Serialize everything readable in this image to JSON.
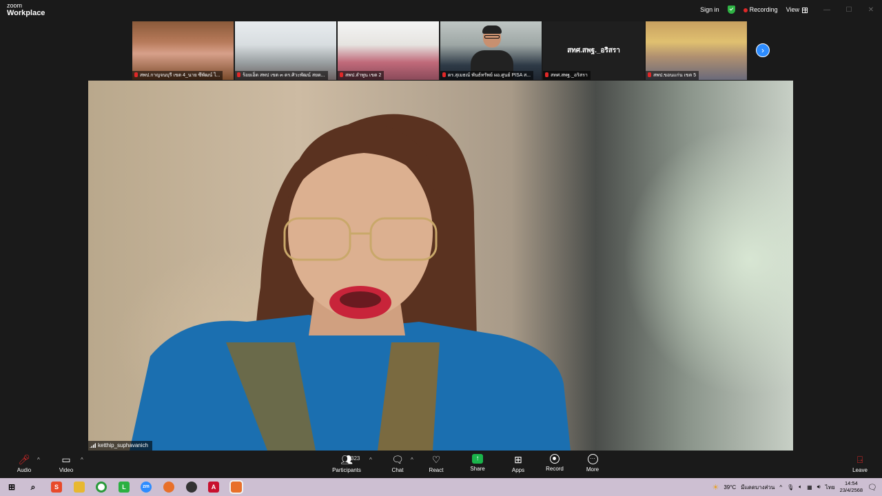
{
  "app": {
    "logo_small": "zoom",
    "logo_big": "Workplace",
    "sign_in": "Sign in",
    "recording": "Recording",
    "view": "View"
  },
  "participants_strip": [
    {
      "label": "สพป.กาญจนบุรี เขต 4_นาย ซึพัฒน์ ไ..."
    },
    {
      "label": "ร้อยเอ็ด สพป เขต ๓ ดร.ศิวะพัฒน์ สยด..."
    },
    {
      "label": "สพป.ลำพูน เขต 2"
    },
    {
      "label": "ดร.สุเมธณ์ พันธ์ทรัพย์ ผอ.ศูนย์ PISA ส..."
    },
    {
      "label": "สทศ.สพฐ._อริสรา",
      "display_name": "สทศ.สพฐ._อริสรา"
    },
    {
      "label": "สพป.ขอนแก่น เขต 5"
    }
  ],
  "main_speaker": {
    "name": "ketthip_suphavanich"
  },
  "toolbar": {
    "audio": "Audio",
    "video": "Video",
    "participants": "Participants",
    "participant_count": "323",
    "chat": "Chat",
    "react": "React",
    "share": "Share",
    "apps": "Apps",
    "record": "Record",
    "more": "More",
    "leave": "Leave"
  },
  "taskbar": {
    "weather": "39°C",
    "weather_desc": "มีแดดบางส่วน",
    "lang": "ไทย",
    "time": "14:54",
    "date": "23/4/2568"
  },
  "colors": {
    "accent_blue": "#2d8cff",
    "share_green": "#1ab44b",
    "record_red": "#e02828"
  }
}
